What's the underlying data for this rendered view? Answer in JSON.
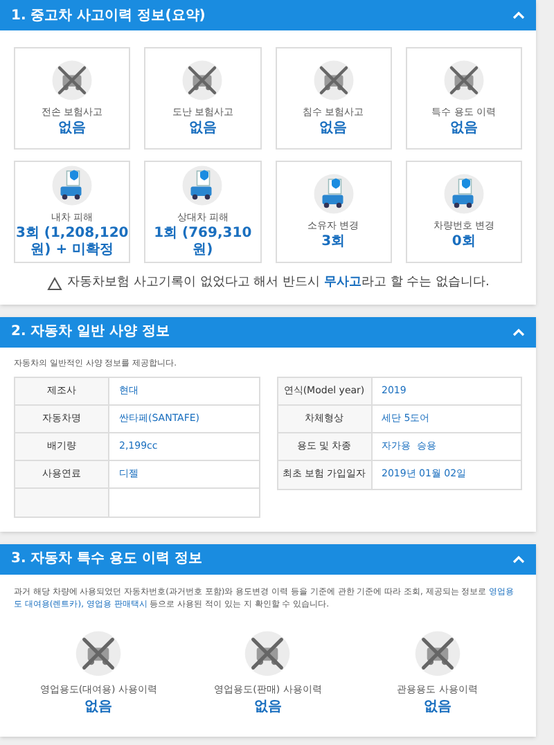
{
  "sections": [
    {
      "kind": "cards",
      "title": "1. 중고차 사고이력 정보(요약)",
      "expanded": true,
      "cards": [
        {
          "kind": "none",
          "label": "전손 보험사고",
          "value": "없음"
        },
        {
          "kind": "none",
          "label": "도난 보험사고",
          "value": "없음"
        },
        {
          "kind": "none",
          "label": "침수 보험사고",
          "value": "없음"
        },
        {
          "kind": "none",
          "label": "특수 용도 이력",
          "value": "없음"
        },
        {
          "kind": "record",
          "label": "내차 피해",
          "value": "3회 (1,208,120 원) + 미확정"
        },
        {
          "kind": "record",
          "label": "상대차 피해",
          "value": "1회 (769,310 원)"
        },
        {
          "kind": "record",
          "label": "소유자 변경",
          "value": "3회"
        },
        {
          "kind": "record",
          "label": "차량번호 변경",
          "value": "0회"
        }
      ],
      "notice": "자동차보험 사고기록이 없었다고 해서 반드시 **무사고**라고 할 수는 없습니다."
    },
    {
      "kind": "tables",
      "title": "2. 자동차 일반 사양 정보",
      "expanded": true,
      "intro": "자동차의 일반적인 사양 정보를 제공합니다.",
      "tables": [
        [
          {
            "kind": "field",
            "label": "제조사",
            "value": "현대"
          },
          {
            "kind": "field",
            "label": "자동차명",
            "value": "싼타페(SANTAFE)"
          },
          {
            "kind": "field",
            "label": "배기량",
            "value": "2,199cc"
          },
          {
            "kind": "field",
            "label": "사용연료",
            "value": "디젤"
          },
          {
            "kind": "blank"
          }
        ],
        [
          {
            "kind": "field",
            "label": "연식(Model year)",
            "value": "2019"
          },
          {
            "kind": "field",
            "label": "차체형상",
            "value": "세단 5도어"
          },
          {
            "kind": "field",
            "label": "용도 및 차종",
            "value": "자가용  승용"
          },
          {
            "kind": "field",
            "label": "최초 보험 가입일자",
            "value": "2019년 01월 02일"
          }
        ]
      ]
    },
    {
      "kind": "usage",
      "title": "3. 자동차 특수 용도 이력 정보",
      "expanded": true,
      "intro": {
        "before": "과거 해당 차량에 사용되었던 자동차번호(과거번호 포함)와 용도변경 이력 등을 기준에 관한 기준에 따라 조회, 제공되는 정보로 ",
        "highlight": "영업용도 대여용(렌트카), 영업용 판매택시",
        "after": " 등으로 사용된 적이 있는 지 확인할 수 있습니다."
      },
      "items": [
        {
          "kind": "none",
          "label": "영업용도(대여용) 사용이력",
          "value": "없음"
        },
        {
          "kind": "none",
          "label": "영업용도(판매) 사용이력",
          "value": "없음"
        },
        {
          "kind": "none",
          "label": "관용용도 사용이력",
          "value": "없음"
        }
      ]
    }
  ]
}
